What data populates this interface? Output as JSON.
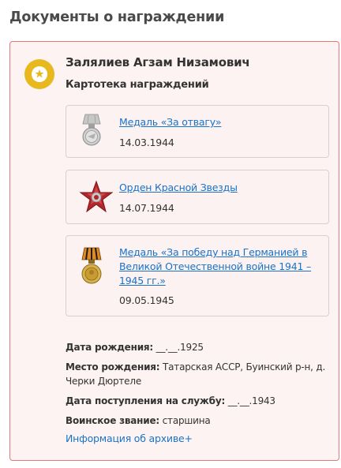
{
  "page_title": "Документы о награждении",
  "person": {
    "name": "Залялиев Агзам Низамович",
    "subtitle": "Картотека награждений",
    "badge_color": "#e8b81f"
  },
  "awards": [
    {
      "name": "Медаль «За отвагу»",
      "date": "14.03.1944",
      "icon": "medal-for-courage-icon"
    },
    {
      "name": "Орден Красной Звезды",
      "date": "14.07.1944",
      "icon": "order-red-star-icon"
    },
    {
      "name": "Медаль «За победу над Германией в Великой Отечественной войне 1941 –1945 гг.»",
      "date": "09.05.1945",
      "icon": "medal-victory-over-germany-icon"
    }
  ],
  "info": {
    "birth_date_label": "Дата рождения:",
    "birth_date_value": "__.__.1925",
    "birth_place_label": "Место рождения:",
    "birth_place_value": "Татарская АССР, Буинский р-н, д. Черки Дюртеле",
    "service_date_label": "Дата поступления на службу:",
    "service_date_value": "__.__.1943",
    "rank_label": "Воинское звание:",
    "rank_value": "старшина"
  },
  "archive_link": "Информация об архиве+",
  "colors": {
    "accent": "#1a73c8",
    "card_border": "#e07a7a",
    "card_bg": "#fdf3f2"
  }
}
